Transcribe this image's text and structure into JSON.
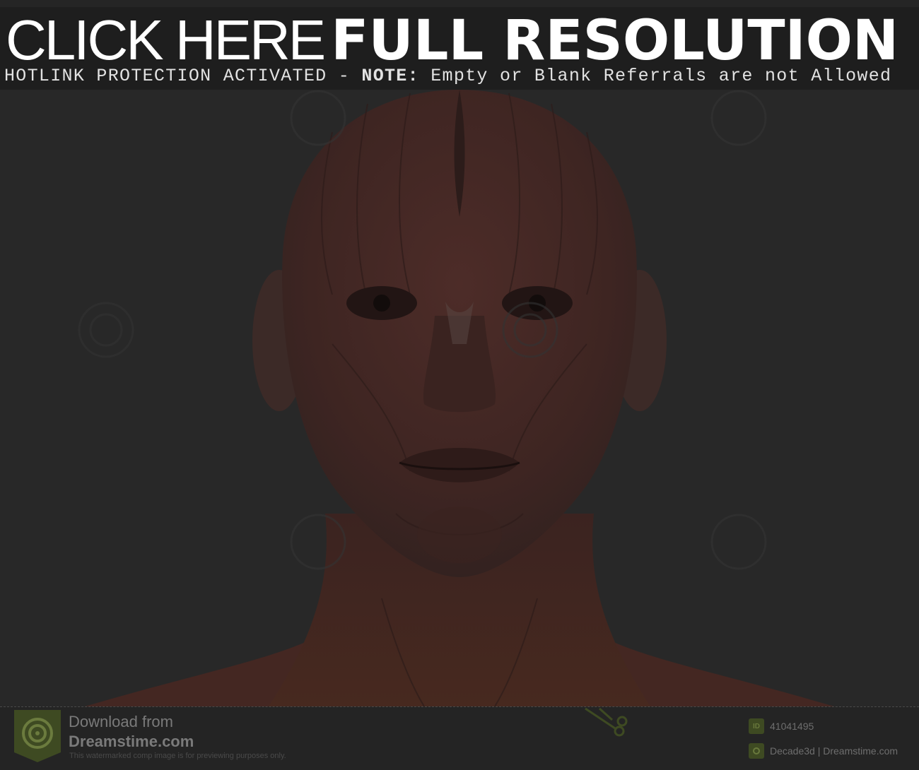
{
  "banner": {
    "title_thin": "CLICK HERE",
    "title_bold": "FULL RESOLUTION",
    "subtitle_main": "HOTLINK PROTECTION ACTIVATED - ",
    "subtitle_note": "NOTE:",
    "subtitle_rest": " Empty or Blank Referrals are not Allowed"
  },
  "footer": {
    "download_from": "Download from",
    "site": "Dreamstime.com",
    "disclaimer": "This watermarked comp image is for previewing purposes only.",
    "id_icon": "ID",
    "image_id": "41041495",
    "author": "Decade3d | Dreamstime.com"
  },
  "colors": {
    "banner_bg": "#1e1e1e",
    "page_bg": "#2a2a2a",
    "muscle": "#4a2a26",
    "badge_green": "#3e4a22"
  },
  "icons": {
    "logo": "dreamstime-spiral-icon",
    "scissors": "scissors-icon",
    "author": "author-icon"
  }
}
